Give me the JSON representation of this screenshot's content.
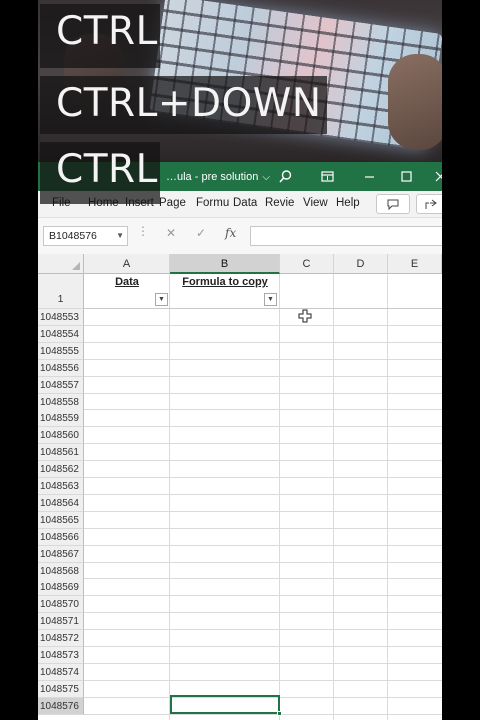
{
  "overlay": {
    "line1": "CTRL",
    "line2": "CTRL+DOWN",
    "line3": "CTRL"
  },
  "titlebar": {
    "doc_title": "…ula - pre solution",
    "chevron": "⌵"
  },
  "ribbon": {
    "tabs": [
      "File",
      "Home",
      "Insert",
      "Page",
      "Formu",
      "Data",
      "Revie",
      "View",
      "Help"
    ]
  },
  "formula_bar": {
    "name_box": "B1048576",
    "formula": ""
  },
  "columns": [
    "A",
    "B",
    "C",
    "D",
    "E"
  ],
  "header_row": {
    "row_label": "1",
    "a": "Data",
    "b": "Formula to copy"
  },
  "rows": [
    "1048553",
    "1048554",
    "1048555",
    "1048556",
    "1048557",
    "1048558",
    "1048559",
    "1048560",
    "1048561",
    "1048562",
    "1048563",
    "1048564",
    "1048565",
    "1048566",
    "1048567",
    "1048568",
    "1048569",
    "1048570",
    "1048571",
    "1048572",
    "1048573",
    "1048574",
    "1048575",
    "1048576"
  ],
  "colors": {
    "excel_green": "#217346",
    "overlay_bg": "#141212"
  },
  "icons": [
    "search-icon",
    "ribbon-display-icon",
    "minimize-icon",
    "maximize-icon",
    "close-icon",
    "comments-icon",
    "share-icon",
    "filter-dropdown-icon",
    "cell-cursor-icon"
  ]
}
